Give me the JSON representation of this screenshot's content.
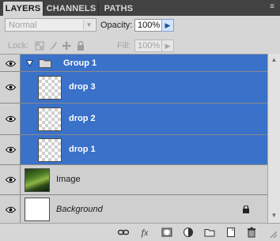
{
  "tabs": [
    {
      "label": "LAYERS",
      "active": true
    },
    {
      "label": "CHANNELS",
      "active": false
    },
    {
      "label": "PATHS",
      "active": false
    }
  ],
  "panel_menu_icon": "panel-menu-icon",
  "blend_mode": {
    "value": "Normal"
  },
  "opacity": {
    "label": "Opacity:",
    "value": "100%"
  },
  "lock": {
    "label": "Lock:",
    "icons": [
      "lock-transparency-icon",
      "lock-paint-icon",
      "lock-move-icon",
      "lock-all-icon"
    ]
  },
  "fill": {
    "label": "Fill:",
    "value": "100%"
  },
  "layers": [
    {
      "name": "Group 1",
      "type": "group",
      "selected": true
    },
    {
      "name": "drop 3",
      "type": "layer",
      "selected": true
    },
    {
      "name": "drop 2",
      "type": "layer",
      "selected": true
    },
    {
      "name": "drop 1",
      "type": "layer",
      "selected": true
    },
    {
      "name": "Image",
      "type": "layer",
      "selected": false
    },
    {
      "name": "Background",
      "type": "background",
      "selected": false,
      "locked": true
    }
  ],
  "bottom_icons": [
    "link-layers-icon",
    "fx-icon",
    "add-mask-icon",
    "adjustment-layer-icon",
    "new-group-icon",
    "new-layer-icon",
    "delete-icon"
  ],
  "colors": {
    "selection": "#3a71c9",
    "panel": "#d6d6d6",
    "tabbar": "#424242"
  }
}
